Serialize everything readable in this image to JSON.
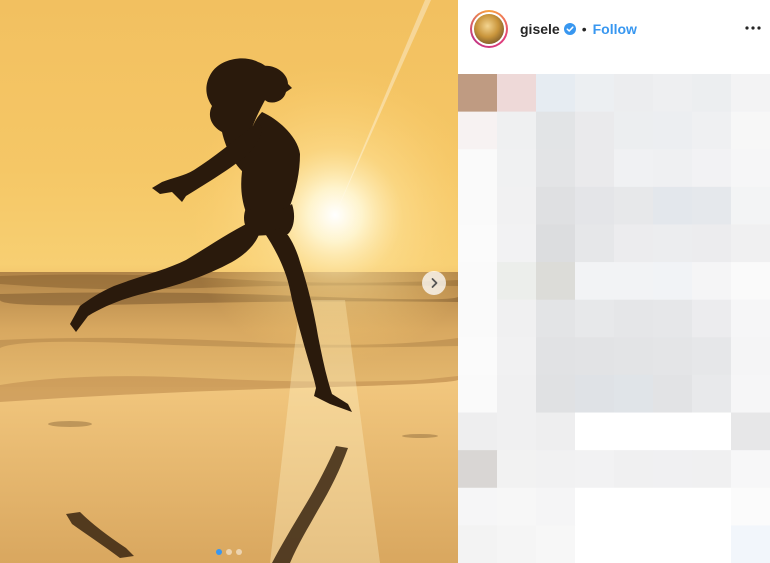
{
  "post": {
    "username": "gisele",
    "separator": "•",
    "follow_label": "Follow",
    "carousel": {
      "slide_count": 3,
      "active_index": 0
    }
  },
  "icons": {
    "next": "chevron-right-icon",
    "verified": "verified-badge-icon",
    "more": "more-options-icon"
  },
  "colors": {
    "accent": "#3897f0",
    "text": "#262626"
  }
}
